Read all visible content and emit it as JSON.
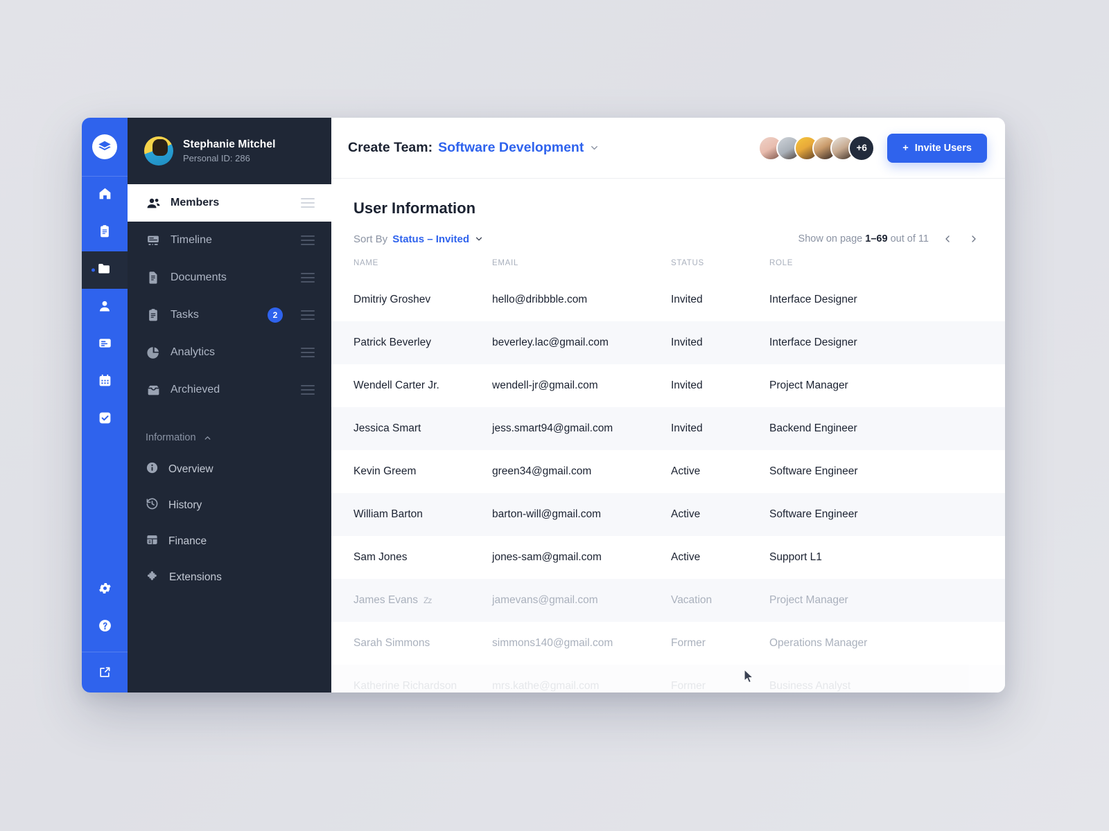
{
  "rail": {
    "logo_icon": "layers-logo-icon",
    "items": [
      {
        "icon": "home-icon",
        "name": "home",
        "active": false,
        "dot": false
      },
      {
        "icon": "clipboard-icon",
        "name": "projects",
        "active": false,
        "dot": false
      },
      {
        "icon": "folder-icon",
        "name": "files",
        "active": true,
        "dot": true
      },
      {
        "icon": "user-icon",
        "name": "contacts",
        "active": false,
        "dot": false
      },
      {
        "icon": "card-icon",
        "name": "billing",
        "active": false,
        "dot": false
      },
      {
        "icon": "calendar-icon",
        "name": "calendar",
        "active": false,
        "dot": true
      },
      {
        "icon": "check-square-icon",
        "name": "tasks",
        "active": false,
        "dot": false
      }
    ],
    "bottom": [
      {
        "icon": "gear-icon",
        "name": "settings"
      },
      {
        "icon": "help-icon",
        "name": "help"
      }
    ],
    "foot": {
      "icon": "external-link-icon",
      "name": "logout"
    }
  },
  "profile": {
    "name": "Stephanie Mitchel",
    "personal_id": "Personal ID: 286",
    "avatar": "user-avatar"
  },
  "nav": {
    "items": [
      {
        "label": "Members",
        "icon": "members-icon",
        "selected": true,
        "badge": null
      },
      {
        "label": "Timeline",
        "icon": "timeline-icon",
        "selected": false,
        "badge": null
      },
      {
        "label": "Documents",
        "icon": "document-icon",
        "selected": false,
        "badge": null
      },
      {
        "label": "Tasks",
        "icon": "tasks-icon",
        "selected": false,
        "badge": "2"
      },
      {
        "label": "Analytics",
        "icon": "analytics-icon",
        "selected": false,
        "badge": null
      },
      {
        "label": "Archieved",
        "icon": "archive-icon",
        "selected": false,
        "badge": null
      }
    ],
    "section": {
      "label": "Information",
      "icon": "chevron-up-icon"
    },
    "sub_items": [
      {
        "label": "Overview",
        "icon": "info-icon"
      },
      {
        "label": "History",
        "icon": "history-icon"
      },
      {
        "label": "Finance",
        "icon": "finance-icon"
      },
      {
        "label": "Extensions",
        "icon": "puzzle-icon"
      }
    ]
  },
  "topbar": {
    "prefix": "Create Team:",
    "team": "Software Development",
    "chevron_icon": "chevron-down-icon",
    "overflow_count": "+6",
    "invite_label": "Invite Users",
    "invite_plus": "+"
  },
  "content": {
    "title": "User Information",
    "sort_label": "Sort By",
    "sort_value": "Status – Invited",
    "sort_chevron": "chevron-down-icon",
    "page_prefix": "Show on page",
    "page_range": "1–69",
    "page_suffix": "out of 11",
    "prev_icon": "chevron-left-icon",
    "next_icon": "chevron-right-icon",
    "columns": [
      "NAME",
      "EMAIL",
      "STATUS",
      "ROLE"
    ],
    "rows": [
      {
        "name": "Dmitriy Groshev",
        "email": "hello@dribbble.com",
        "status": "Invited",
        "role": "Interface Designer",
        "muted": false,
        "sleep": false
      },
      {
        "name": "Patrick Beverley",
        "email": "beverley.lac@gmail.com",
        "status": "Invited",
        "role": "Interface Designer",
        "muted": false,
        "sleep": false
      },
      {
        "name": "Wendell Carter Jr.",
        "email": "wendell-jr@gmail.com",
        "status": "Invited",
        "role": "Project Manager",
        "muted": false,
        "sleep": false
      },
      {
        "name": "Jessica Smart",
        "email": "jess.smart94@gmail.com",
        "status": "Invited",
        "role": "Backend Engineer",
        "muted": false,
        "sleep": false
      },
      {
        "name": "Kevin Greem",
        "email": "green34@gmail.com",
        "status": "Active",
        "role": "Software Engineer",
        "muted": false,
        "sleep": false
      },
      {
        "name": "William Barton",
        "email": "barton-will@gmail.com",
        "status": "Active",
        "role": "Software Engineer",
        "muted": false,
        "sleep": false
      },
      {
        "name": "Sam Jones",
        "email": "jones-sam@gmail.com",
        "status": "Active",
        "role": "Support L1",
        "muted": false,
        "sleep": false
      },
      {
        "name": "James Evans",
        "email": "jamevans@gmail.com",
        "status": "Vacation",
        "role": "Project Manager",
        "muted": true,
        "sleep": true
      },
      {
        "name": "Sarah Simmons",
        "email": "simmons140@gmail.com",
        "status": "Former",
        "role": "Operations Manager",
        "muted": true,
        "sleep": false
      },
      {
        "name": "Katherine Richardson",
        "email": "mrs.kathe@gmail.com",
        "status": "Former",
        "role": "Business Analyst",
        "muted": true,
        "sleep": false
      }
    ],
    "sleep_glyph": "Zz"
  },
  "colors": {
    "accent": "#2f63ed",
    "nav_dark": "#1f2736",
    "rail_blue": "#2f63ed",
    "zebra": "#f7f8fb",
    "text_dark": "#1b2231",
    "muted": "#aab1bd"
  }
}
